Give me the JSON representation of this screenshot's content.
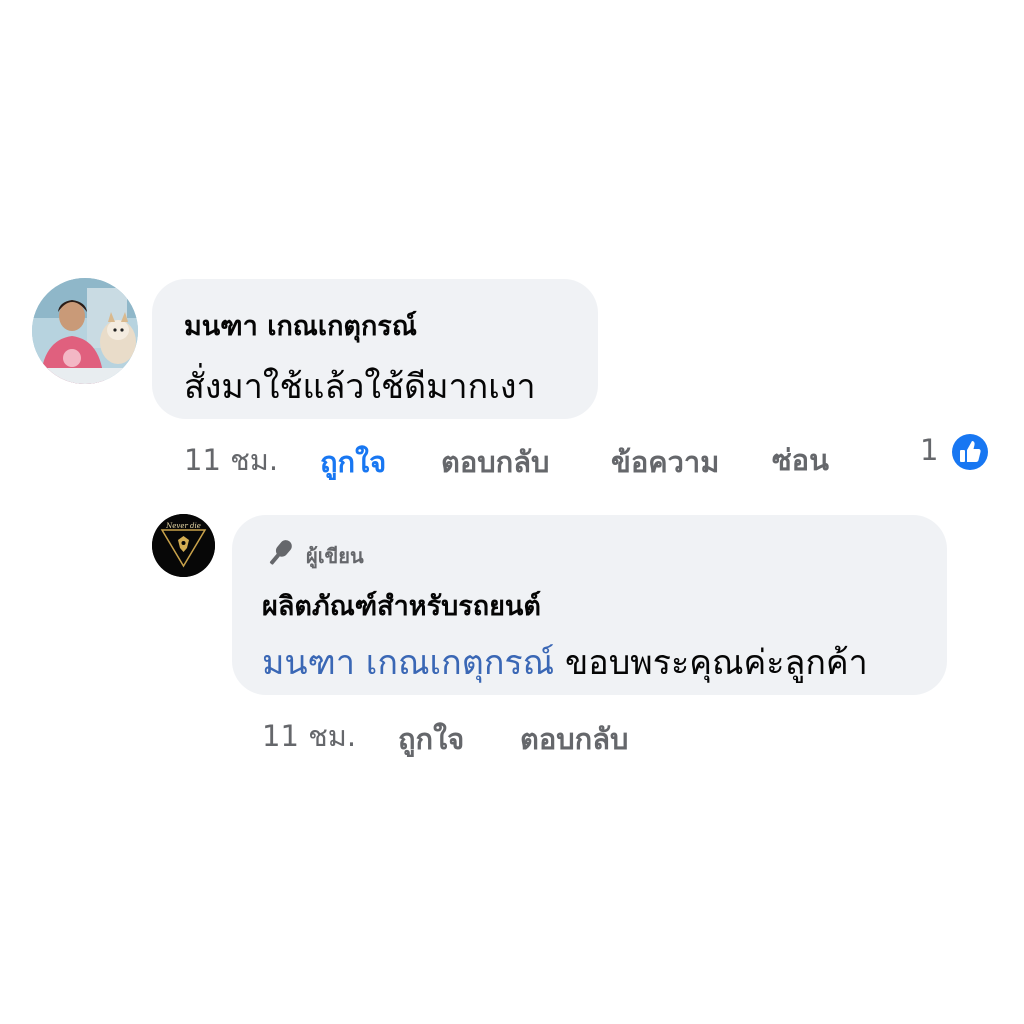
{
  "comment": {
    "author": "มนฑา เกณเกตุกรณ์",
    "text": "สั่งมาใช้แล้วใช้ดีมากเงา",
    "time": "11 ชม.",
    "actions": {
      "like": "ถูกใจ",
      "reply": "ตอบกลับ",
      "message": "ข้อความ",
      "hide": "ซ่อน"
    },
    "like_state": "liked",
    "reaction_count": "1",
    "reaction_icon": "thumbs-up-icon",
    "avatar_icon": "user-photo"
  },
  "reply": {
    "badge_label": "ผู้เขียน",
    "badge_icon": "microphone-icon",
    "author": "ผลิตภัณฑ์สำหรับรถยนต์",
    "mention": "มนฑา เกณเกตุกรณ์",
    "text": "ขอบพระคุณค่ะลูกค้า",
    "time": "11 ชม.",
    "actions": {
      "like": "ถูกใจ",
      "reply": "ตอบกลับ"
    },
    "avatar_icon": "page-logo",
    "avatar_logo_text": "Never die"
  },
  "colors": {
    "bubble": "#f0f2f5",
    "secondary_text": "#65676b",
    "liked_blue": "#1877f2",
    "mention_blue": "#3a67b5"
  }
}
